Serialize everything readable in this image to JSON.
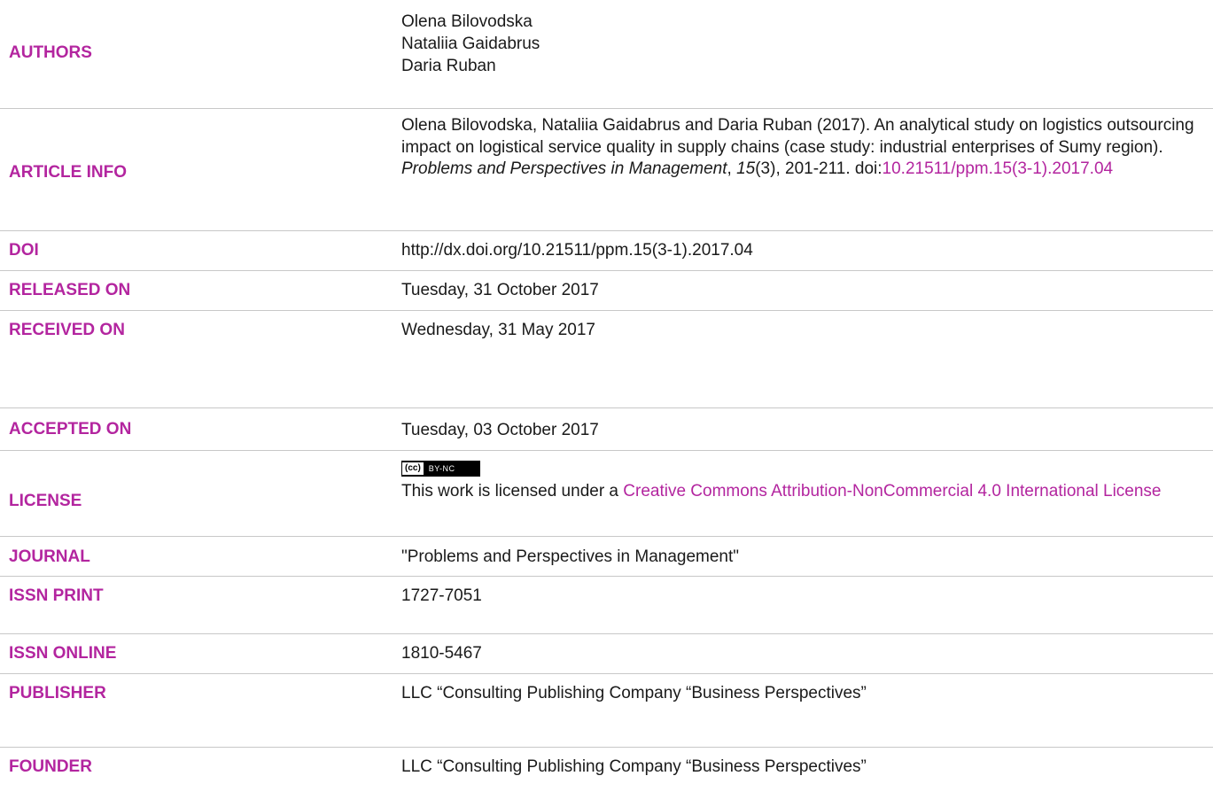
{
  "rows": {
    "authors": {
      "label": "AUTHORS",
      "names": [
        "Olena Bilovodska",
        "Nataliia Gaidabrus",
        "Daria Ruban"
      ]
    },
    "article_info": {
      "label": "ARTICLE INFO",
      "lead": "Olena Bilovodska, Nataliia Gaidabrus and Daria Ruban (2017). An analytical study on logistics outsourcing impact on logistical service quality in supply chains (case study: industrial enterprises of Sumy region).",
      "journal_italic": "Problems and Perspectives in Management",
      "comma1": ", ",
      "volume_italic": "15",
      "issue_pages": "(3), 201-211. doi:",
      "doi_link": "10.21511/ppm.15(3-1).2017.04"
    },
    "doi": {
      "label": "DOI",
      "value": "http://dx.doi.org/10.21511/ppm.15(3-1).2017.04"
    },
    "released_on": {
      "label": "RELEASED ON",
      "value": "Tuesday, 31 October 2017"
    },
    "received_on": {
      "label": "RECEIVED ON",
      "value": "Wednesday, 31 May 2017"
    },
    "accepted_on": {
      "label": "ACCEPTED ON",
      "value": "Tuesday, 03 October 2017"
    },
    "license": {
      "label": "LICENSE",
      "badge_cc": "(cc)",
      "badge_terms": "BY-NC",
      "text": "This work is licensed under a ",
      "link": "Creative Commons Attribution-NonCommercial 4.0 International License"
    },
    "journal": {
      "label": "JOURNAL",
      "value": "\"Problems and Perspectives in Management\""
    },
    "issn_print": {
      "label": "ISSN PRINT",
      "value": "1727-7051"
    },
    "issn_online": {
      "label": "ISSN ONLINE",
      "value": "1810-5467"
    },
    "publisher": {
      "label": "PUBLISHER",
      "value": "LLC “Consulting Publishing Company “Business Perspectives”"
    },
    "founder": {
      "label": "FOUNDER",
      "value": "LLC “Consulting Publishing Company “Business Perspectives”"
    }
  },
  "colors": {
    "accent": "#b3259f",
    "text": "#1a1a1a",
    "divider": "#c8c8c8"
  }
}
